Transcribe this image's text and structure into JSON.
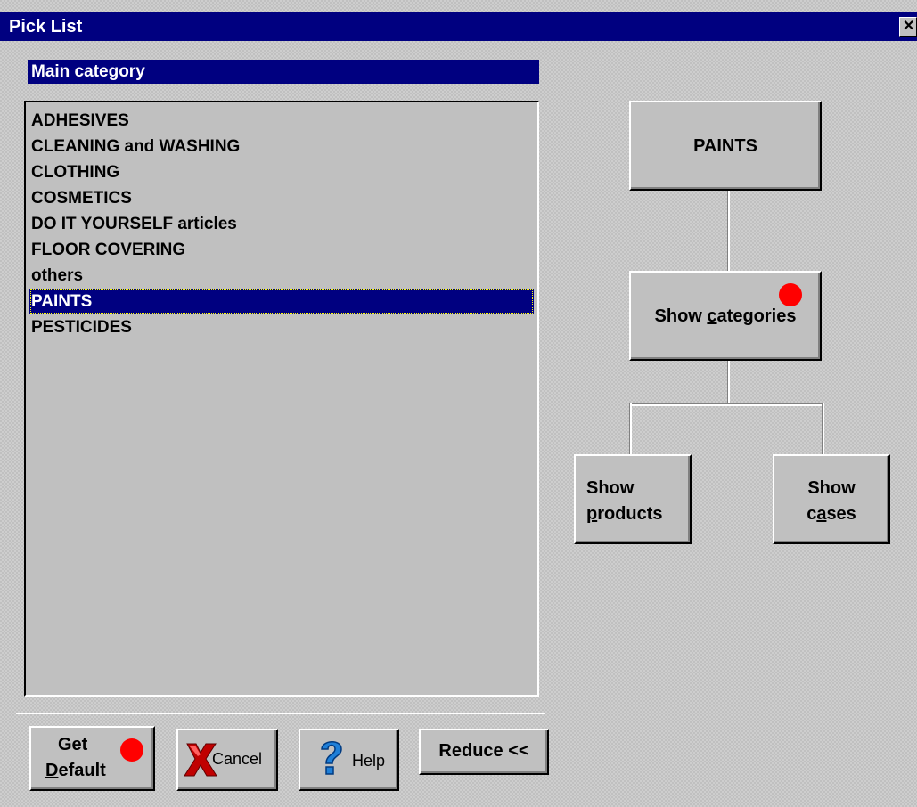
{
  "window": {
    "title": "Pick List",
    "close_glyph": "✕"
  },
  "list": {
    "header": "Main category",
    "items": [
      {
        "label": "ADHESIVES",
        "selected": false
      },
      {
        "label": "CLEANING and WASHING",
        "selected": false
      },
      {
        "label": "CLOTHING",
        "selected": false
      },
      {
        "label": "COSMETICS",
        "selected": false
      },
      {
        "label": "DO IT YOURSELF articles",
        "selected": false
      },
      {
        "label": "FLOOR COVERING",
        "selected": false
      },
      {
        "label": "others",
        "selected": false
      },
      {
        "label": "PAINTS",
        "selected": true
      },
      {
        "label": "PESTICIDES",
        "selected": false
      }
    ]
  },
  "tree": {
    "root_label": "PAINTS",
    "categories_label_pre": "Show ",
    "categories_label_accel": "c",
    "categories_label_post": "ategories",
    "products_line1": "Show",
    "products_accel": "p",
    "products_post": "roducts",
    "cases_line1": "Show",
    "cases_pre": "c",
    "cases_accel": "a",
    "cases_post": "ses"
  },
  "buttons": {
    "get_default_line1": "Get",
    "get_default_accel": "D",
    "get_default_post": "efault",
    "cancel_label": "Cancel",
    "help_label": "Help",
    "reduce_label": "Reduce <<"
  },
  "icons": {
    "cancel": "red-x-icon",
    "help": "blue-question-icon",
    "close": "close-icon"
  },
  "colors": {
    "titlebar": "#000080",
    "selection": "#000080",
    "indicator_dot": "#ff0000",
    "face": "#c0c0c0"
  }
}
